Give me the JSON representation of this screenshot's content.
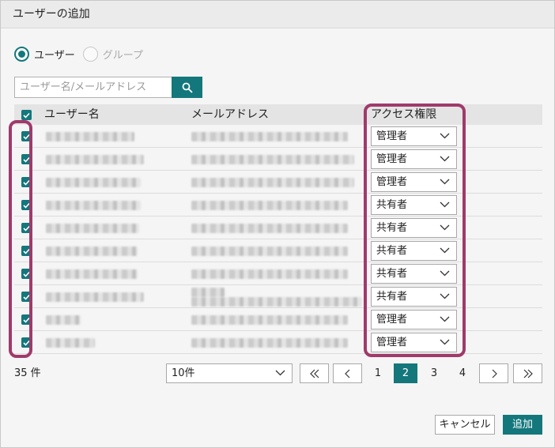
{
  "dialog": {
    "title": "ユーザーの追加"
  },
  "scope": {
    "options": [
      {
        "label": "ユーザー",
        "selected": true
      },
      {
        "label": "グループ",
        "selected": false
      }
    ]
  },
  "search": {
    "placeholder": "ユーザー名/メールアドレス",
    "value": ""
  },
  "table": {
    "headers": {
      "user": "ユーザー名",
      "email": "メールアドレス",
      "access": "アクセス権限"
    },
    "rows": [
      {
        "checked": true,
        "access": "管理者"
      },
      {
        "checked": true,
        "access": "管理者"
      },
      {
        "checked": true,
        "access": "管理者"
      },
      {
        "checked": true,
        "access": "共有者"
      },
      {
        "checked": true,
        "access": "共有者"
      },
      {
        "checked": true,
        "access": "共有者"
      },
      {
        "checked": true,
        "access": "共有者"
      },
      {
        "checked": true,
        "access": "共有者"
      },
      {
        "checked": true,
        "access": "管理者"
      },
      {
        "checked": true,
        "access": "管理者"
      }
    ]
  },
  "footer": {
    "count": "35 件",
    "page_size": "10件"
  },
  "pagination": {
    "pages": [
      "1",
      "2",
      "3",
      "4"
    ],
    "current": "2"
  },
  "buttons": {
    "cancel": "キャンセル",
    "add": "追加"
  },
  "colors": {
    "accent": "#13777c",
    "highlight": "#a03a6a"
  }
}
